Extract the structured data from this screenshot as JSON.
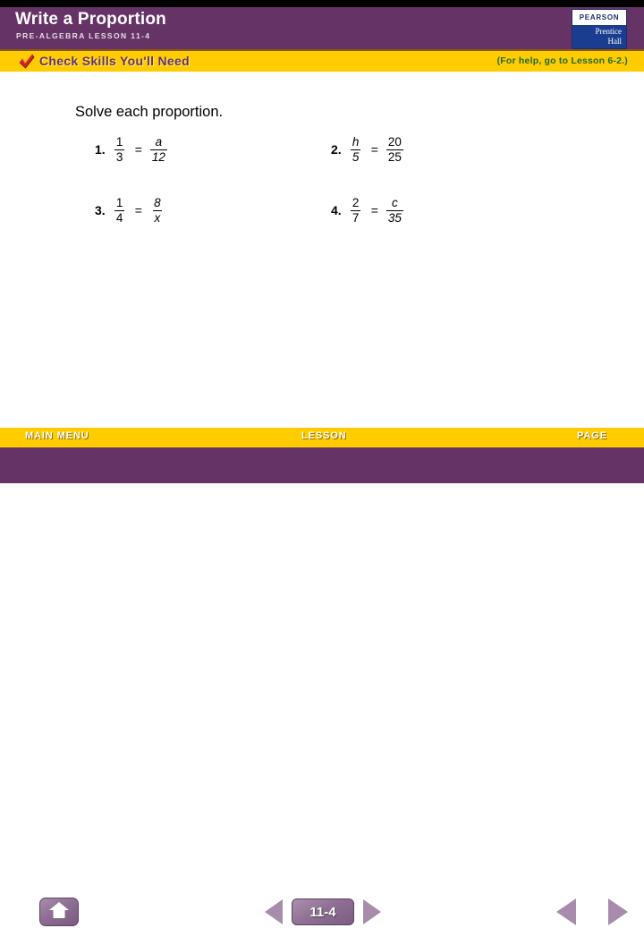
{
  "header": {
    "title": "Write a Proportion",
    "subtitle": "PRE-ALGEBRA LESSON 11-4",
    "logo": {
      "top_text": "PEARSON",
      "bottom_line1": "Prentice",
      "bottom_line2": "Hall"
    }
  },
  "banner": {
    "label": "Check Skills You'll Need",
    "help_note": "(For help, go to Lesson 6-2.)",
    "icon": "check-mark-icon"
  },
  "main": {
    "prompt": "Solve each proportion.",
    "problems": [
      {
        "number": "1.",
        "left": {
          "numerator": "1",
          "denominator": "3",
          "italic": false
        },
        "operator": "=",
        "right": {
          "numerator": "a",
          "denominator": "12",
          "italic": true
        }
      },
      {
        "number": "2.",
        "left": {
          "numerator": "h",
          "denominator": "5",
          "italic": true
        },
        "operator": "=",
        "right": {
          "numerator": "20",
          "denominator": "25",
          "italic": false
        }
      },
      {
        "number": "3.",
        "left": {
          "numerator": "1",
          "denominator": "4",
          "italic": false
        },
        "operator": "=",
        "right": {
          "numerator": "8",
          "denominator": "x",
          "italic": true
        }
      },
      {
        "number": "4.",
        "left": {
          "numerator": "2",
          "denominator": "7",
          "italic": false
        },
        "operator": "=",
        "right": {
          "numerator": "c",
          "denominator": "35",
          "italic": true
        }
      }
    ]
  },
  "nav": {
    "main_menu_label": "MAIN MENU",
    "lesson_label": "LESSON",
    "page_label": "PAGE",
    "lesson_number": "11-4",
    "home_icon": "home-icon",
    "prev_lesson_icon": "triangle-left-icon",
    "next_lesson_icon": "triangle-right-icon",
    "prev_page_icon": "triangle-left-icon",
    "next_page_icon": "triangle-right-icon"
  },
  "colors": {
    "purple": "#663366",
    "yellow": "#ffcc00",
    "green_help": "#1f6b2e",
    "logo_blue": "#1b3d8f"
  }
}
